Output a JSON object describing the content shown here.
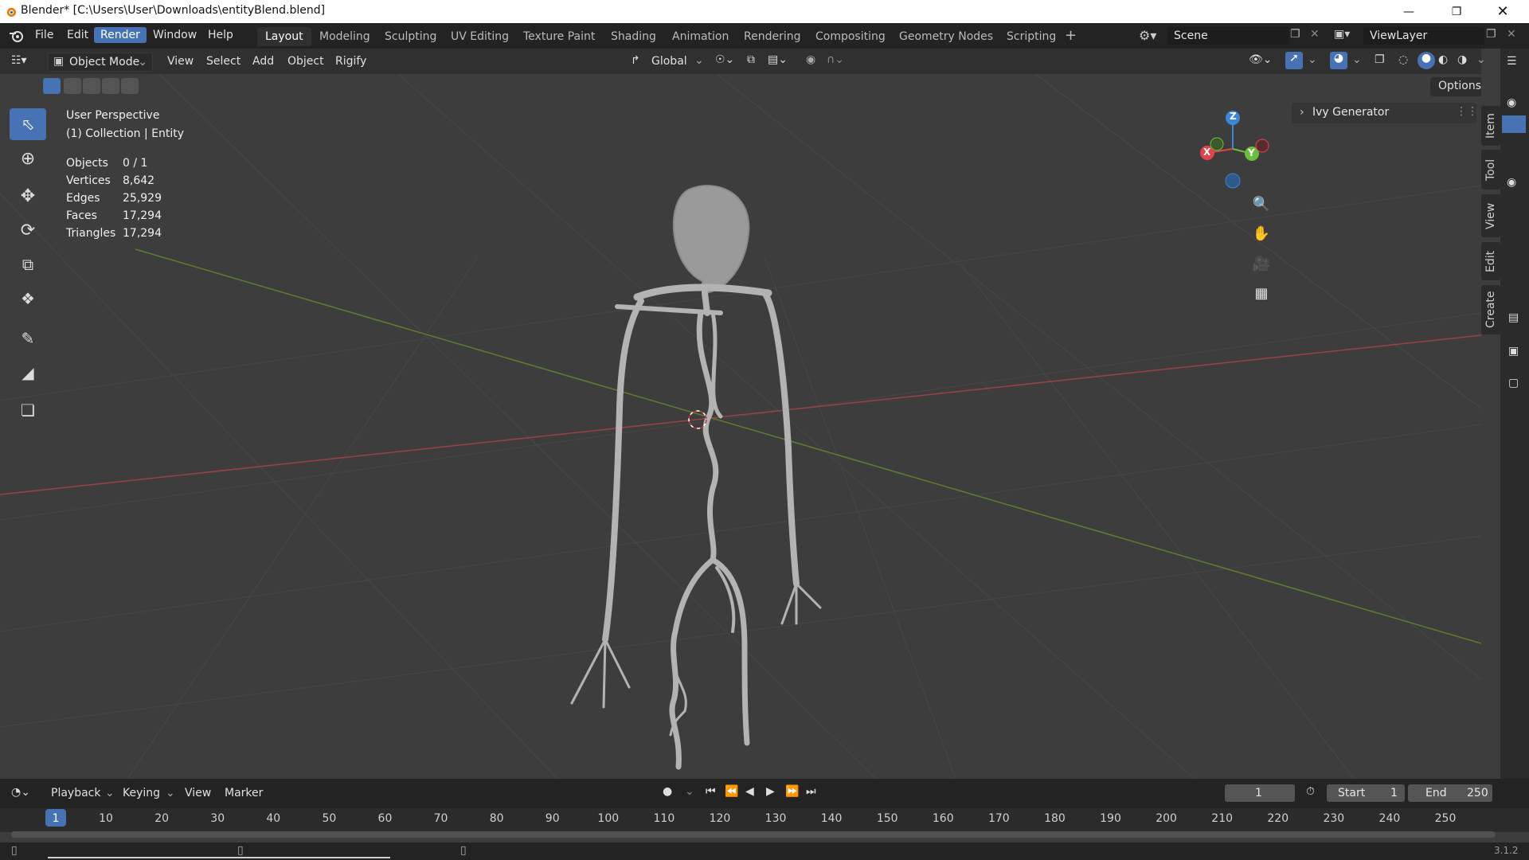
{
  "window": {
    "title": "Blender* [C:\\Users\\User\\Downloads\\entityBlend.blend]"
  },
  "menu": [
    "File",
    "Edit",
    "Render",
    "Window",
    "Help"
  ],
  "workspaces": [
    "Layout",
    "Modeling",
    "Sculpting",
    "UV Editing",
    "Texture Paint",
    "Shading",
    "Animation",
    "Rendering",
    "Compositing",
    "Geometry Nodes",
    "Scripting"
  ],
  "scene": {
    "name": "Scene",
    "view_layer": "ViewLayer"
  },
  "viewport_header": {
    "mode": "Object Mode",
    "menus": [
      "View",
      "Select",
      "Add",
      "Object",
      "Rigify"
    ],
    "transform_orientation": "Global",
    "options": "Options"
  },
  "overlay": {
    "view_name": "User Perspective",
    "collection": "(1) Collection | Entity",
    "stats": [
      {
        "label": "Objects",
        "value": "0 / 1"
      },
      {
        "label": "Vertices",
        "value": "8,642"
      },
      {
        "label": "Edges",
        "value": "25,929"
      },
      {
        "label": "Faces",
        "value": "17,294"
      },
      {
        "label": "Triangles",
        "value": "17,294"
      }
    ]
  },
  "gizmo": {
    "x": "X",
    "y": "Y",
    "z": "Z"
  },
  "panel": {
    "ivy_generator": "Ivy Generator"
  },
  "sidebar_tabs": [
    "Item",
    "Tool",
    "View",
    "Edit",
    "Create"
  ],
  "timeline": {
    "menus": [
      "Playback",
      "Keying",
      "View",
      "Marker"
    ],
    "current_frame": "1",
    "start_label": "Start",
    "start": "1",
    "end_label": "End",
    "end": "250",
    "ticks": [
      "1",
      "10",
      "20",
      "30",
      "40",
      "50",
      "60",
      "70",
      "80",
      "90",
      "100",
      "110",
      "120",
      "130",
      "140",
      "150",
      "160",
      "170",
      "180",
      "190",
      "200",
      "210",
      "220",
      "230",
      "240",
      "250"
    ]
  },
  "version": "3.1.2",
  "colors": {
    "accent": "#4772b3",
    "x_axis": "#e2424f",
    "y_axis": "#6bbd3d",
    "z_axis": "#3c86d6"
  }
}
